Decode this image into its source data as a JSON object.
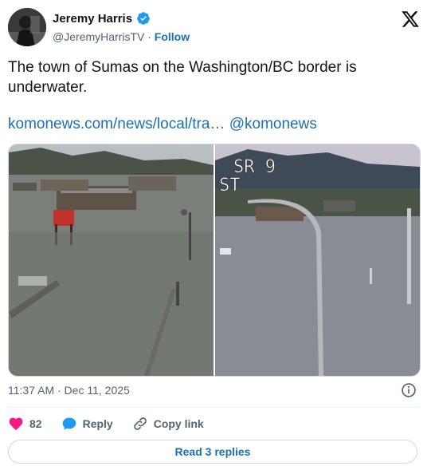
{
  "author": {
    "name": "Jeremy Harris",
    "handle": "@JeremyHarrisTV",
    "separator": "·",
    "follow_label": "Follow"
  },
  "tweet": {
    "text": "The town of Sumas on the Washington/BC border is underwater.",
    "link_text": "komonews.com/news/local/tra…",
    "mention": "@komonews"
  },
  "media": {
    "right_overlay_line1": "SR 9",
    "right_overlay_line2": "ST"
  },
  "meta": {
    "timestamp": "11:37 AM · Dec 11, 2025"
  },
  "actions": {
    "like_count": "82",
    "reply_label": "Reply",
    "copy_link_label": "Copy link"
  },
  "footer": {
    "read_replies_label": "Read 3 replies"
  },
  "colors": {
    "link": "#1d6fb8",
    "like": "#f91880",
    "verified": "#1d9bf0",
    "muted_text": "#536471"
  }
}
